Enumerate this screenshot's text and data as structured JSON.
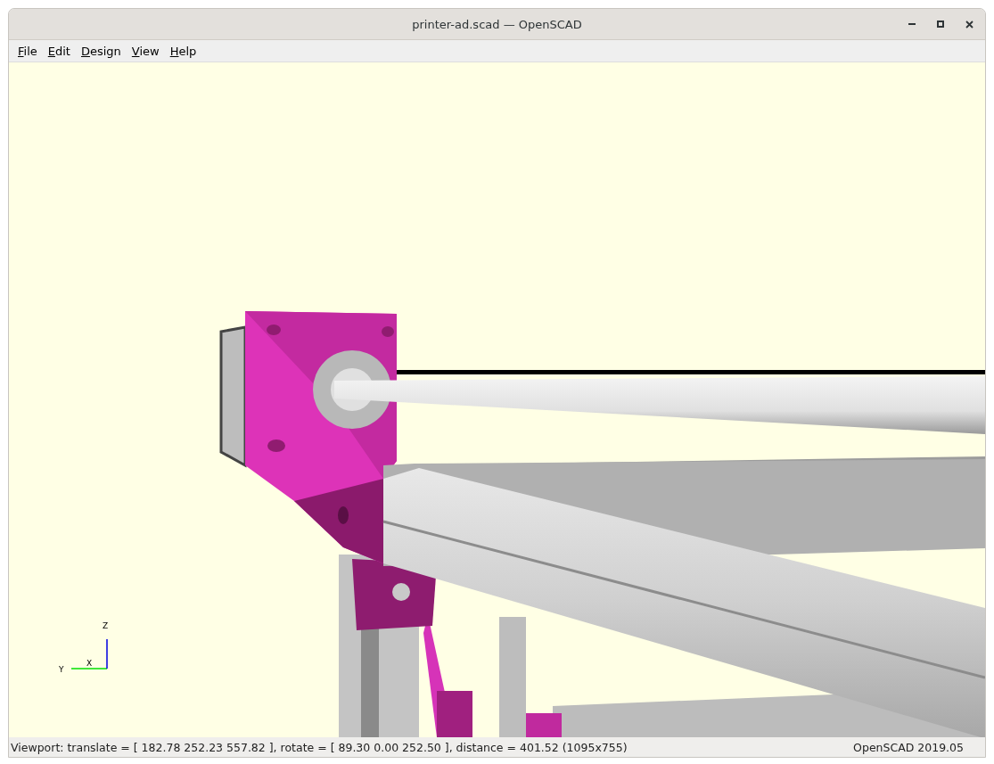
{
  "window": {
    "title": "printer-ad.scad — OpenSCAD"
  },
  "menu": [
    {
      "label": "File"
    },
    {
      "label": "Edit"
    },
    {
      "label": "Design"
    },
    {
      "label": "View"
    },
    {
      "label": "Help"
    }
  ],
  "viewport": {
    "axes": {
      "x": "X",
      "y": "Y",
      "z": "Z"
    }
  },
  "status_bar": {
    "viewport_info": "Viewport: translate = [ 182.78 252.23 557.82 ], rotate = [ 89.30 0.00 252.50 ], distance = 401.52 (1095x755)",
    "version": "OpenSCAD 2019.05"
  }
}
